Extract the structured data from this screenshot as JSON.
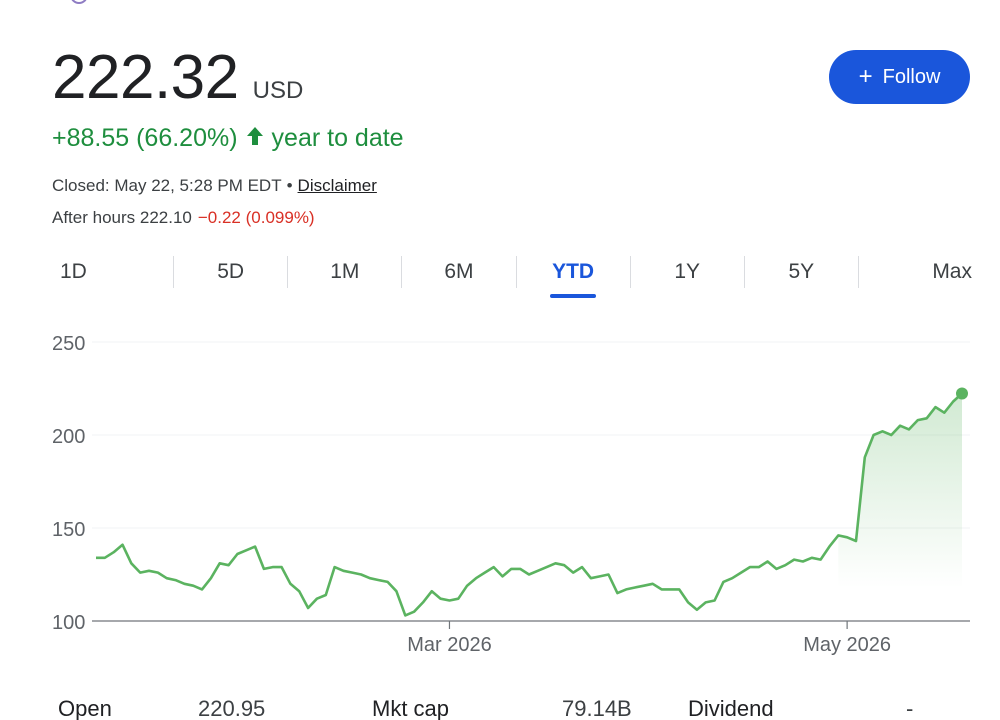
{
  "quote": {
    "price": "222.32",
    "currency": "USD",
    "change": "+88.55 (66.20%)",
    "change_arrow": "🠕",
    "change_period": "year to date",
    "closed_label": "Closed: May 22, 5:28 PM EDT",
    "separator": "•",
    "disclaimer": "Disclaimer",
    "after_hours_label": "After hours 222.10",
    "after_hours_change": "−0.22 (0.099%)"
  },
  "follow": {
    "label": "Follow",
    "icon": "plus-icon"
  },
  "ranges": [
    {
      "label": "1D",
      "active": false
    },
    {
      "label": "5D",
      "active": false
    },
    {
      "label": "1M",
      "active": false
    },
    {
      "label": "6M",
      "active": false
    },
    {
      "label": "YTD",
      "active": true
    },
    {
      "label": "1Y",
      "active": false
    },
    {
      "label": "5Y",
      "active": false
    },
    {
      "label": "Max",
      "active": false
    }
  ],
  "colors": {
    "accent": "#1a56db",
    "positive": "#1e8e3e",
    "negative": "#d93025",
    "line": "#5bb360"
  },
  "chart_data": {
    "type": "area",
    "ylim": [
      100,
      250
    ],
    "yticks": [
      100,
      150,
      200,
      250
    ],
    "xticks": [
      {
        "label": "Mar 2026",
        "index": 40
      },
      {
        "label": "May 2026",
        "index": 85
      }
    ],
    "grid": true,
    "series": [
      {
        "values": [
          134,
          134,
          137,
          141,
          131,
          126,
          127,
          126,
          123,
          122,
          120,
          119,
          117,
          123,
          131,
          130,
          136,
          138,
          140,
          128,
          129,
          129,
          120,
          116,
          107,
          112,
          114,
          129,
          127,
          126,
          125,
          123,
          122,
          121,
          116,
          103,
          105,
          110,
          116,
          112,
          111,
          112,
          119,
          123,
          126,
          129,
          124,
          128,
          128,
          125,
          127,
          129,
          131,
          130,
          126,
          129,
          123,
          124,
          125,
          115,
          117,
          118,
          119,
          120,
          117,
          117,
          117,
          110,
          106,
          110,
          111,
          121,
          123,
          126,
          129,
          129,
          132,
          128,
          130,
          133,
          132,
          134,
          133,
          140,
          146,
          145,
          143,
          188,
          200,
          202,
          200,
          205,
          203,
          208,
          209,
          215,
          212,
          218,
          222.32
        ]
      }
    ]
  },
  "stats": [
    {
      "label": "Open",
      "value": "220.95"
    },
    {
      "label": "Mkt cap",
      "value": "79.14B"
    },
    {
      "label": "Dividend",
      "value": "-"
    }
  ]
}
